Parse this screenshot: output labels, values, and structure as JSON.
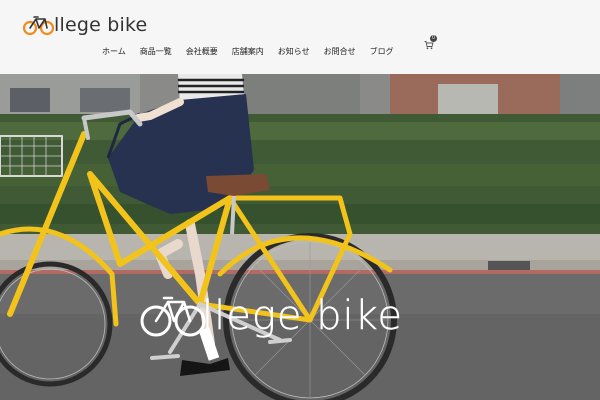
{
  "brand": {
    "logo_text": "llege bike",
    "logo_color": "#f08c1e"
  },
  "nav": {
    "items": [
      {
        "label": "ホーム"
      },
      {
        "label": "商品一覧"
      },
      {
        "label": "会社概要"
      },
      {
        "label": "店舗案内"
      },
      {
        "label": "お知らせ"
      },
      {
        "label": "お問合せ"
      },
      {
        "label": "ブログ"
      }
    ]
  },
  "cart": {
    "icon": "cart-icon",
    "count": "0"
  },
  "hero": {
    "title_text": "llege bike",
    "title_color": "#ffffff",
    "bike_color": "#f2c31b"
  }
}
